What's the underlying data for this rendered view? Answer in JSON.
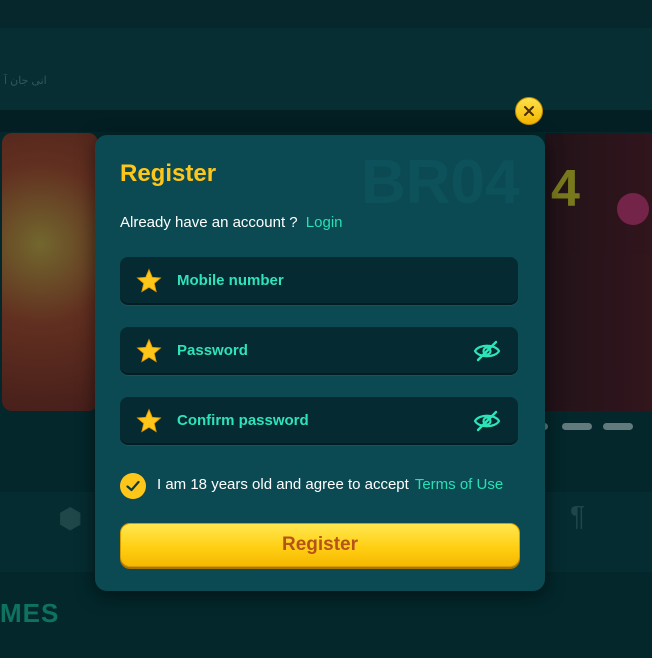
{
  "background": {
    "header_text": "انی جان آ",
    "games_heading": "MES"
  },
  "modal": {
    "title": "Register",
    "watermark": "BR04",
    "login_prompt": "Already have an account ?",
    "login_link": "Login",
    "fields": [
      {
        "label": "Mobile number",
        "has_visibility_toggle": false
      },
      {
        "label": "Password",
        "has_visibility_toggle": true
      },
      {
        "label": "Confirm password",
        "has_visibility_toggle": true
      }
    ],
    "agree_text": "I am 18 years old and agree to accept",
    "agree_checked": true,
    "terms_link": "Terms of Use",
    "register_button": "Register"
  },
  "colors": {
    "accent_yellow": "#ffc61a",
    "accent_teal": "#28e0b5",
    "modal_bg": "#0b4a52",
    "field_bg": "#062a31",
    "button_text": "#b5531a"
  },
  "icons": {
    "close": "close-icon",
    "required": "star-icon",
    "visibility": "eye-off-icon",
    "checkbox": "check-icon"
  }
}
